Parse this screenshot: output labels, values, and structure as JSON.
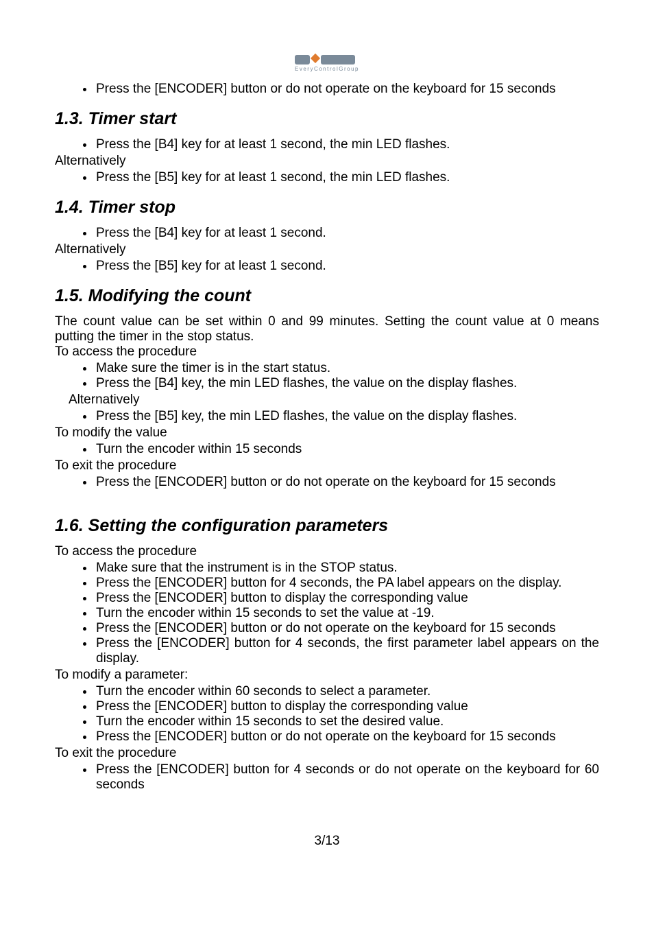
{
  "logo": {
    "subtext": "EveryControlGroup"
  },
  "b0": "Press the [ENCODER] button or do not operate on the keyboard for 15 seconds",
  "s13": {
    "heading": "1.3.  Timer start",
    "b1": "Press the [B4] key for at least 1 second, the min LED flashes.",
    "alt": "Alternatively",
    "b2": "Press the [B5] key for at least 1 second, the min LED flashes."
  },
  "s14": {
    "heading": "1.4.  Timer stop",
    "b1": "Press the [B4] key for at least 1 second.",
    "alt": "Alternatively",
    "b2": "Press the [B5] key for at least 1 second."
  },
  "s15": {
    "heading": "1.5.  Modifying the count",
    "intro": "The count value can be set within 0 and 99 minutes. Setting the count value at 0 means putting the timer in the stop status.",
    "access": "To access the procedure",
    "b1": "Make sure the timer is in the start status.",
    "b2": "Press the [B4] key, the min LED flashes, the value on the display flashes.",
    "alt": "Alternatively",
    "b3": "Press the [B5] key, the min LED flashes, the value on the display flashes.",
    "modify": "To modify the value",
    "b4": "Turn the encoder within 15 seconds",
    "exit": "To exit the procedure",
    "b5": "Press the [ENCODER] button or do not operate on the keyboard for 15 seconds"
  },
  "s16": {
    "heading": "1.6.  Setting the configuration parameters",
    "access": "To access the procedure",
    "b1": "Make sure that the instrument is in the STOP status.",
    "b2": "Press the [ENCODER] button for 4 seconds, the PA label appears on the display.",
    "b3": "Press the [ENCODER] button to display the corresponding value",
    "b4": "Turn the encoder within 15 seconds to set the value at -19.",
    "b5": "Press the [ENCODER] button or do not operate on the keyboard for 15 seconds",
    "b6": "Press the [ENCODER] button for 4 seconds, the first parameter label appears on the display.",
    "modify": "To modify a parameter:",
    "b7": "Turn the encoder within 60 seconds to select a parameter.",
    "b8": "Press the [ENCODER] button to display the corresponding value",
    "b9": "Turn the encoder within 15 seconds to set the desired value.",
    "b10": "Press the [ENCODER] button or do not operate on the keyboard for 15 seconds",
    "exit": "To exit the procedure",
    "b11": "Press the [ENCODER] button for 4 seconds or do not operate on the keyboard for 60 seconds"
  },
  "footer": "3/13"
}
